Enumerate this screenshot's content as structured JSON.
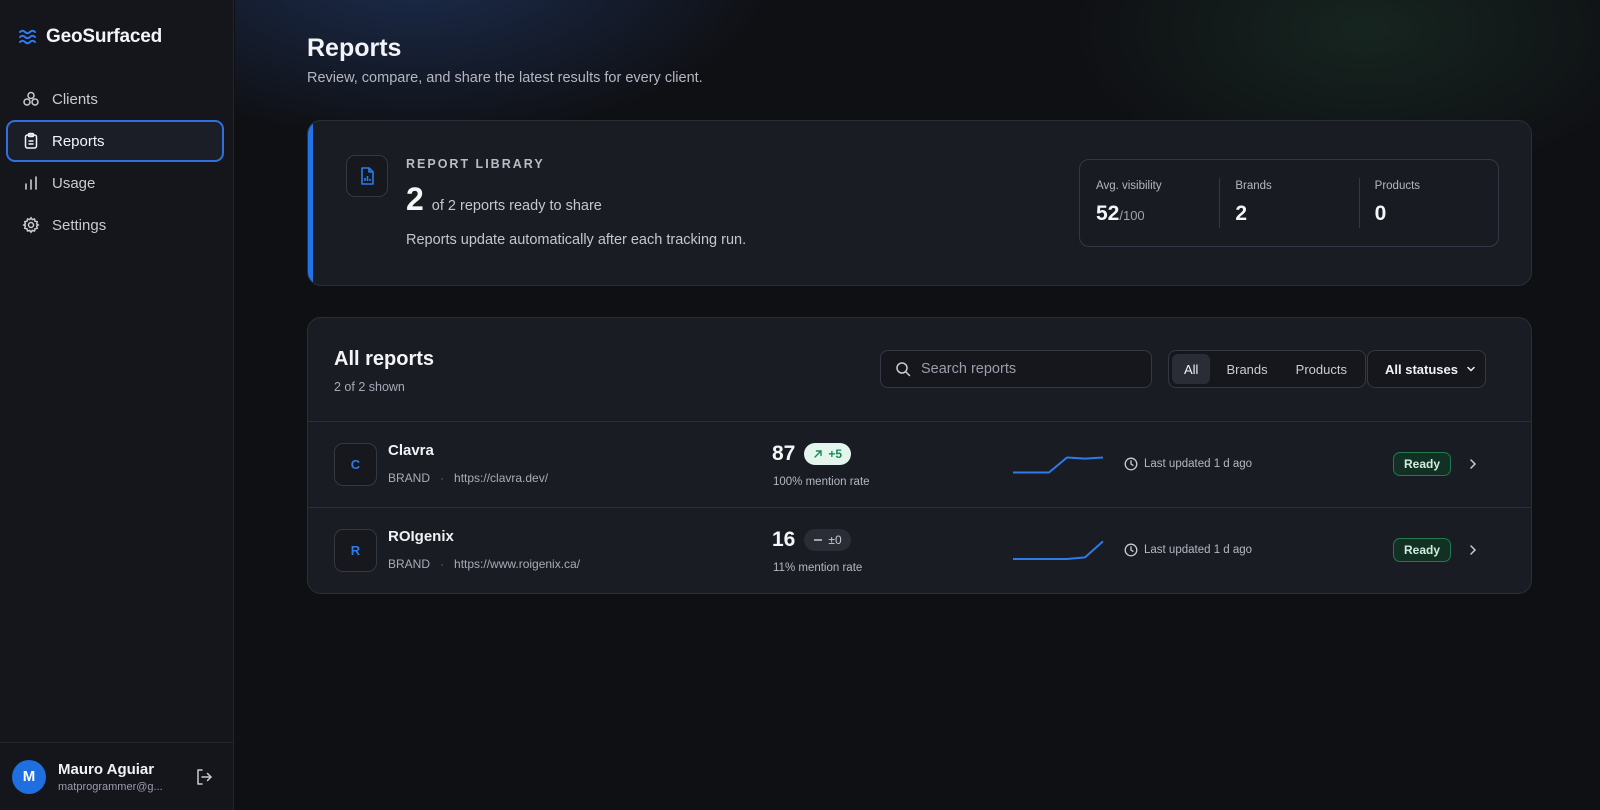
{
  "app": {
    "name": "GeoSurfaced"
  },
  "sidebar": {
    "items": [
      {
        "label": "Clients",
        "icon": "clients-icon"
      },
      {
        "label": "Reports",
        "icon": "clipboard-icon",
        "active": true
      },
      {
        "label": "Usage",
        "icon": "bar-chart-icon"
      },
      {
        "label": "Settings",
        "icon": "gear-icon"
      }
    ],
    "user": {
      "initial": "M",
      "name": "Mauro Aguiar",
      "email": "matprogrammer@g..."
    }
  },
  "page": {
    "title": "Reports",
    "subtitle": "Review, compare, and share the latest results for every client."
  },
  "library": {
    "label": "REPORT LIBRARY",
    "count": "2",
    "count_text": "of 2 reports ready to share",
    "note": "Reports update automatically after each tracking run.",
    "stats": [
      {
        "label": "Avg. visibility",
        "value": "52",
        "unit": "/100"
      },
      {
        "label": "Brands",
        "value": "2"
      },
      {
        "label": "Products",
        "value": "0"
      }
    ]
  },
  "reports": {
    "title": "All reports",
    "shown": "2 of 2 shown",
    "search_placeholder": "Search reports",
    "filters": [
      "All",
      "Brands",
      "Products"
    ],
    "active_filter": "All",
    "status_select": "All statuses",
    "rows": [
      {
        "initial": "C",
        "name": "Clavra",
        "type": "BRAND",
        "url": "https://clavra.dev/",
        "score": "87",
        "delta": "+5",
        "delta_trend": "up",
        "mention_rate": "100% mention rate",
        "spark": [
          78,
          78,
          78,
          92,
          91,
          92
        ],
        "updated": "Last updated 1 d ago",
        "status": "Ready"
      },
      {
        "initial": "R",
        "name": "ROIgenix",
        "type": "BRAND",
        "url": "https://www.roigenix.ca/",
        "score": "16",
        "delta": "±0",
        "delta_trend": "flat",
        "mention_rate": "11% mention rate",
        "spark": [
          5,
          5,
          5,
          5,
          6,
          16
        ],
        "updated": "Last updated 1 d ago",
        "status": "Ready"
      }
    ]
  },
  "colors": {
    "accent": "#2273e6",
    "ready_bg": "#123024",
    "ready_border": "#1f7a4d",
    "up_bg": "#e3f5ec",
    "up_text": "#158a55"
  }
}
